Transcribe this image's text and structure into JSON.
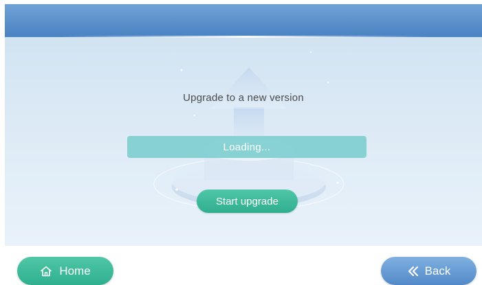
{
  "main": {
    "title": "Upgrade to a new version",
    "progress_text": "Loading...",
    "start_label": "Start upgrade"
  },
  "footer": {
    "home_label": "Home",
    "home_icon": "home-icon",
    "back_label": "Back",
    "back_icon": "double-chevron-left-icon"
  },
  "colors": {
    "header": "#4a83c2",
    "accent_green": "#2fae8e",
    "progress": "#78cccc",
    "back_blue": "#5289c8"
  }
}
